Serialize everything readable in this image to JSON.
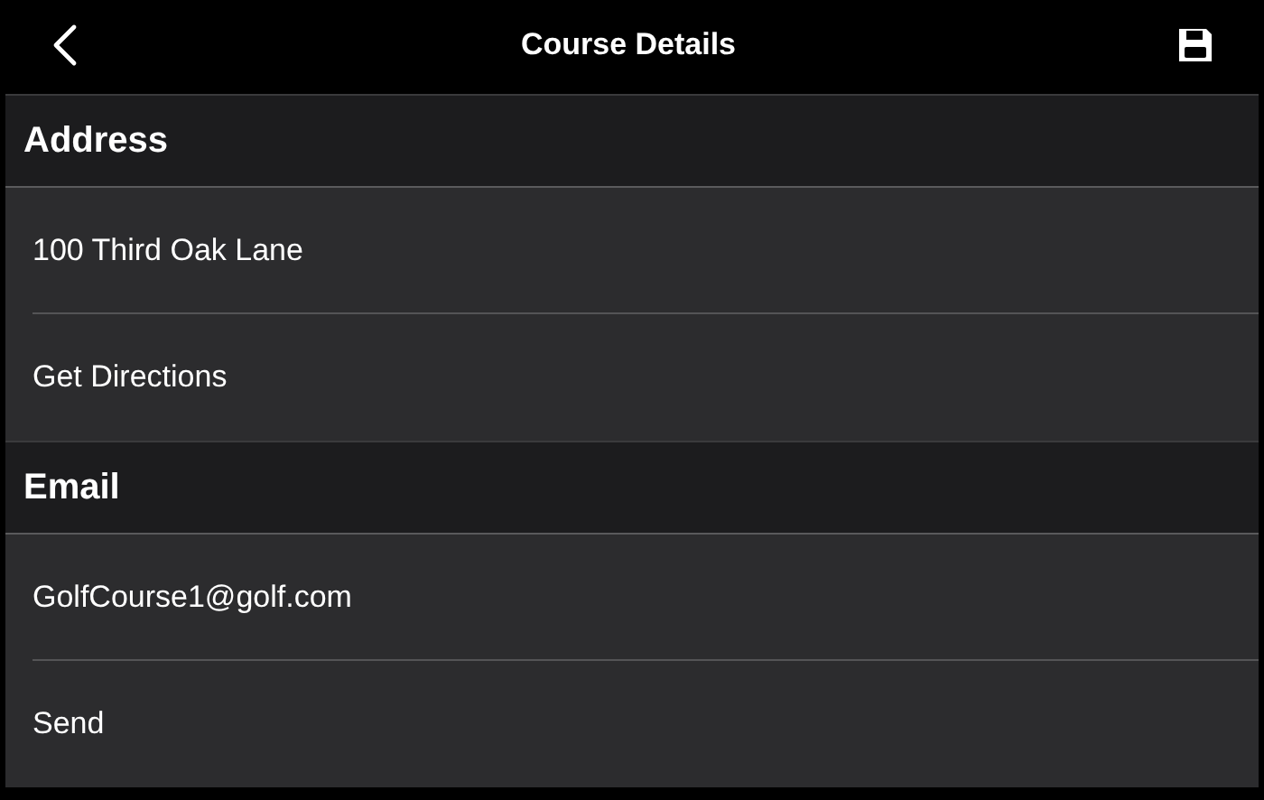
{
  "nav_bar": {
    "title": "Course Details"
  },
  "sections": [
    {
      "title": "Address",
      "rows": [
        "100 Third Oak Lane",
        "Get Directions"
      ]
    },
    {
      "title": "Email",
      "rows": [
        "GolfCourse1@golf.com",
        "Send"
      ]
    }
  ]
}
